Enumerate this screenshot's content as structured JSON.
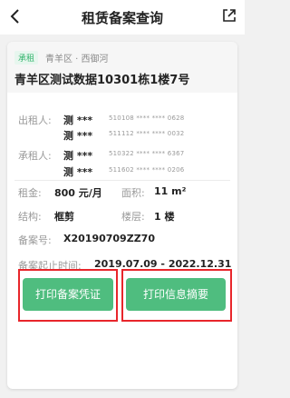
{
  "nav": {
    "title": "租赁备案查询"
  },
  "property": {
    "tag": "承租",
    "district": "青羊区 · 西御河",
    "address": "青羊区测试数据10301栋1楼7号"
  },
  "lessor": {
    "label": "出租人:",
    "people": [
      {
        "name": "测 ***",
        "id": "510108 **** **** 0628"
      },
      {
        "name": "测 ***",
        "id": "511112 **** **** 0032"
      }
    ]
  },
  "lessee": {
    "label": "承租人:",
    "people": [
      {
        "name": "测 ***",
        "id": "510322 **** **** 6367"
      },
      {
        "name": "测 ***",
        "id": "511602 **** **** 0206"
      }
    ]
  },
  "details": {
    "rent_label": "租金:",
    "rent_value": "800 元/月",
    "area_label": "面积:",
    "area_value": "11 m²",
    "structure_label": "结构:",
    "structure_value": "框剪",
    "floor_label": "楼层:",
    "floor_value": "1 楼",
    "record_no_label": "备案号:",
    "record_no_value": "X20190709ZZ70",
    "period_label": "备案起止时间:",
    "period_value": "2019.07.09 - 2022.12.31"
  },
  "actions": {
    "print_certificate": "打印备案凭证",
    "print_summary": "打印信息摘要"
  },
  "colors": {
    "accent": "#4fbd7f",
    "highlight": "#e8262b"
  },
  "icons": {
    "back": "chevron-left-icon",
    "share": "share-icon"
  }
}
